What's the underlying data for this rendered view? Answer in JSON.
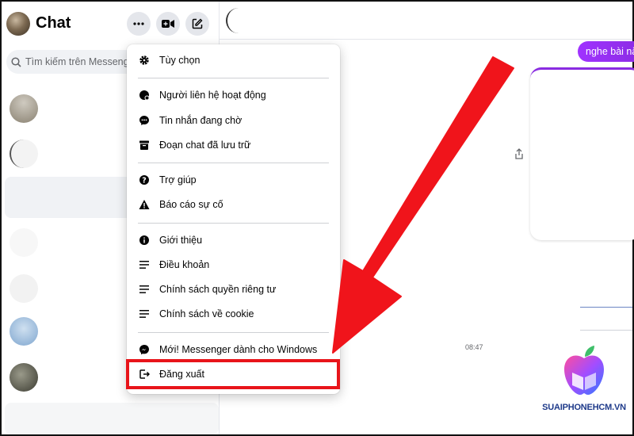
{
  "sidebar": {
    "title": "Chat",
    "search_placeholder": "Tìm kiếm trên Messenger"
  },
  "menu": {
    "groups": [
      [
        {
          "label": "Tùy chọn",
          "icon": "gear-icon"
        }
      ],
      [
        {
          "label": "Người liên hệ hoạt động",
          "icon": "active-contacts-icon"
        },
        {
          "label": "Tin nhắn đang chờ",
          "icon": "chat-bubble-icon"
        },
        {
          "label": "Đoạn chat đã lưu trữ",
          "icon": "archive-icon"
        }
      ],
      [
        {
          "label": "Trợ giúp",
          "icon": "help-icon"
        },
        {
          "label": "Báo cáo sự cố",
          "icon": "warning-icon"
        }
      ],
      [
        {
          "label": "Giới thiệu",
          "icon": "info-icon"
        },
        {
          "label": "Điều khoản",
          "icon": "lines-icon"
        },
        {
          "label": "Chính sách quyền riêng tư",
          "icon": "lines-icon"
        },
        {
          "label": "Chính sách về cookie",
          "icon": "lines-icon"
        }
      ],
      [
        {
          "label": "Mới! Messenger dành cho Windows",
          "icon": "messenger-icon"
        },
        {
          "label": "Đăng xuất",
          "icon": "logout-icon"
        }
      ]
    ]
  },
  "conversation": {
    "outgoing_message": "nghe bài nă",
    "timestamp": "08:47"
  },
  "watermark": {
    "text": "SUAIPHONEHCM.VN"
  },
  "colors": {
    "accent_purple": "#8a2be2",
    "highlight_red": "#e8141a",
    "arrow_red": "#f0141b"
  }
}
